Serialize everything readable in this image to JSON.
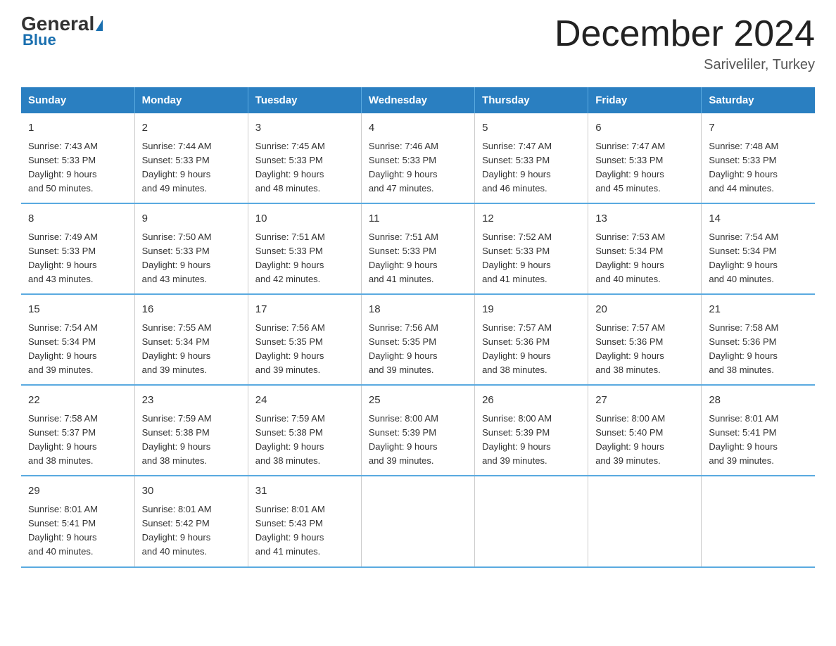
{
  "logo": {
    "general": "General",
    "blue": "Blue"
  },
  "header": {
    "title": "December 2024",
    "subtitle": "Sariveliler, Turkey"
  },
  "columns": [
    "Sunday",
    "Monday",
    "Tuesday",
    "Wednesday",
    "Thursday",
    "Friday",
    "Saturday"
  ],
  "weeks": [
    [
      {
        "day": "1",
        "sunrise": "7:43 AM",
        "sunset": "5:33 PM",
        "daylight": "9 hours and 50 minutes."
      },
      {
        "day": "2",
        "sunrise": "7:44 AM",
        "sunset": "5:33 PM",
        "daylight": "9 hours and 49 minutes."
      },
      {
        "day": "3",
        "sunrise": "7:45 AM",
        "sunset": "5:33 PM",
        "daylight": "9 hours and 48 minutes."
      },
      {
        "day": "4",
        "sunrise": "7:46 AM",
        "sunset": "5:33 PM",
        "daylight": "9 hours and 47 minutes."
      },
      {
        "day": "5",
        "sunrise": "7:47 AM",
        "sunset": "5:33 PM",
        "daylight": "9 hours and 46 minutes."
      },
      {
        "day": "6",
        "sunrise": "7:47 AM",
        "sunset": "5:33 PM",
        "daylight": "9 hours and 45 minutes."
      },
      {
        "day": "7",
        "sunrise": "7:48 AM",
        "sunset": "5:33 PM",
        "daylight": "9 hours and 44 minutes."
      }
    ],
    [
      {
        "day": "8",
        "sunrise": "7:49 AM",
        "sunset": "5:33 PM",
        "daylight": "9 hours and 43 minutes."
      },
      {
        "day": "9",
        "sunrise": "7:50 AM",
        "sunset": "5:33 PM",
        "daylight": "9 hours and 43 minutes."
      },
      {
        "day": "10",
        "sunrise": "7:51 AM",
        "sunset": "5:33 PM",
        "daylight": "9 hours and 42 minutes."
      },
      {
        "day": "11",
        "sunrise": "7:51 AM",
        "sunset": "5:33 PM",
        "daylight": "9 hours and 41 minutes."
      },
      {
        "day": "12",
        "sunrise": "7:52 AM",
        "sunset": "5:33 PM",
        "daylight": "9 hours and 41 minutes."
      },
      {
        "day": "13",
        "sunrise": "7:53 AM",
        "sunset": "5:34 PM",
        "daylight": "9 hours and 40 minutes."
      },
      {
        "day": "14",
        "sunrise": "7:54 AM",
        "sunset": "5:34 PM",
        "daylight": "9 hours and 40 minutes."
      }
    ],
    [
      {
        "day": "15",
        "sunrise": "7:54 AM",
        "sunset": "5:34 PM",
        "daylight": "9 hours and 39 minutes."
      },
      {
        "day": "16",
        "sunrise": "7:55 AM",
        "sunset": "5:34 PM",
        "daylight": "9 hours and 39 minutes."
      },
      {
        "day": "17",
        "sunrise": "7:56 AM",
        "sunset": "5:35 PM",
        "daylight": "9 hours and 39 minutes."
      },
      {
        "day": "18",
        "sunrise": "7:56 AM",
        "sunset": "5:35 PM",
        "daylight": "9 hours and 39 minutes."
      },
      {
        "day": "19",
        "sunrise": "7:57 AM",
        "sunset": "5:36 PM",
        "daylight": "9 hours and 38 minutes."
      },
      {
        "day": "20",
        "sunrise": "7:57 AM",
        "sunset": "5:36 PM",
        "daylight": "9 hours and 38 minutes."
      },
      {
        "day": "21",
        "sunrise": "7:58 AM",
        "sunset": "5:36 PM",
        "daylight": "9 hours and 38 minutes."
      }
    ],
    [
      {
        "day": "22",
        "sunrise": "7:58 AM",
        "sunset": "5:37 PM",
        "daylight": "9 hours and 38 minutes."
      },
      {
        "day": "23",
        "sunrise": "7:59 AM",
        "sunset": "5:38 PM",
        "daylight": "9 hours and 38 minutes."
      },
      {
        "day": "24",
        "sunrise": "7:59 AM",
        "sunset": "5:38 PM",
        "daylight": "9 hours and 38 minutes."
      },
      {
        "day": "25",
        "sunrise": "8:00 AM",
        "sunset": "5:39 PM",
        "daylight": "9 hours and 39 minutes."
      },
      {
        "day": "26",
        "sunrise": "8:00 AM",
        "sunset": "5:39 PM",
        "daylight": "9 hours and 39 minutes."
      },
      {
        "day": "27",
        "sunrise": "8:00 AM",
        "sunset": "5:40 PM",
        "daylight": "9 hours and 39 minutes."
      },
      {
        "day": "28",
        "sunrise": "8:01 AM",
        "sunset": "5:41 PM",
        "daylight": "9 hours and 39 minutes."
      }
    ],
    [
      {
        "day": "29",
        "sunrise": "8:01 AM",
        "sunset": "5:41 PM",
        "daylight": "9 hours and 40 minutes."
      },
      {
        "day": "30",
        "sunrise": "8:01 AM",
        "sunset": "5:42 PM",
        "daylight": "9 hours and 40 minutes."
      },
      {
        "day": "31",
        "sunrise": "8:01 AM",
        "sunset": "5:43 PM",
        "daylight": "9 hours and 41 minutes."
      },
      null,
      null,
      null,
      null
    ]
  ],
  "labels": {
    "sunrise": "Sunrise:",
    "sunset": "Sunset:",
    "daylight": "Daylight:"
  }
}
